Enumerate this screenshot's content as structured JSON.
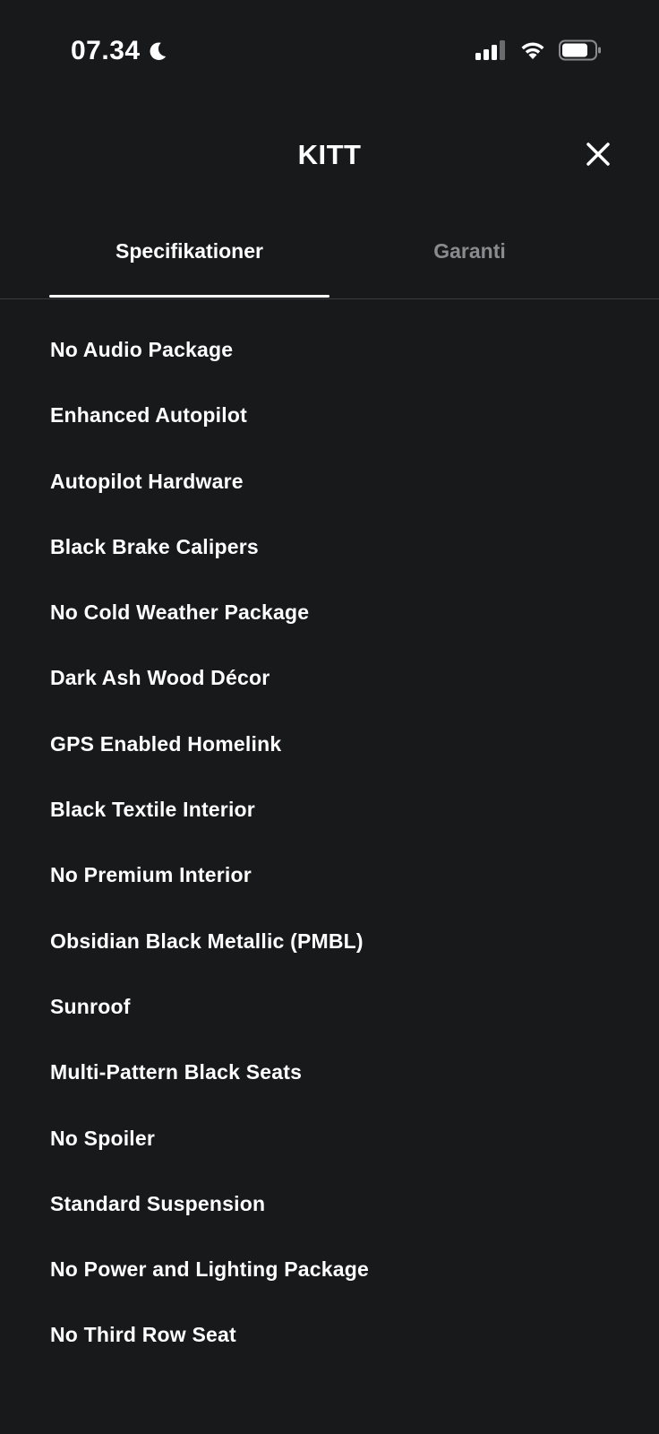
{
  "status_bar": {
    "time": "07.34",
    "icons": [
      "moon-icon",
      "signal-icon",
      "wifi-icon",
      "battery-icon"
    ]
  },
  "header": {
    "title": "KITT",
    "close_icon": "close-icon"
  },
  "tabs": [
    {
      "label": "Specifikationer",
      "active": true
    },
    {
      "label": "Garanti",
      "active": false
    }
  ],
  "specs": [
    "No Audio Package",
    "Enhanced Autopilot",
    "Autopilot Hardware",
    "Black Brake Calipers",
    "No Cold Weather Package",
    "Dark Ash Wood Décor",
    "GPS Enabled Homelink",
    "Black Textile Interior",
    "No Premium Interior",
    "Obsidian Black Metallic (PMBL)",
    "Sunroof",
    "Multi-Pattern Black Seats",
    "No Spoiler",
    "Standard Suspension",
    "No Power and Lighting Package",
    "No Third Row Seat"
  ],
  "colors": {
    "background": "#18191b",
    "text": "#ffffff",
    "inactive_tab": "#8a8b8f",
    "divider": "#3a3b3e"
  }
}
